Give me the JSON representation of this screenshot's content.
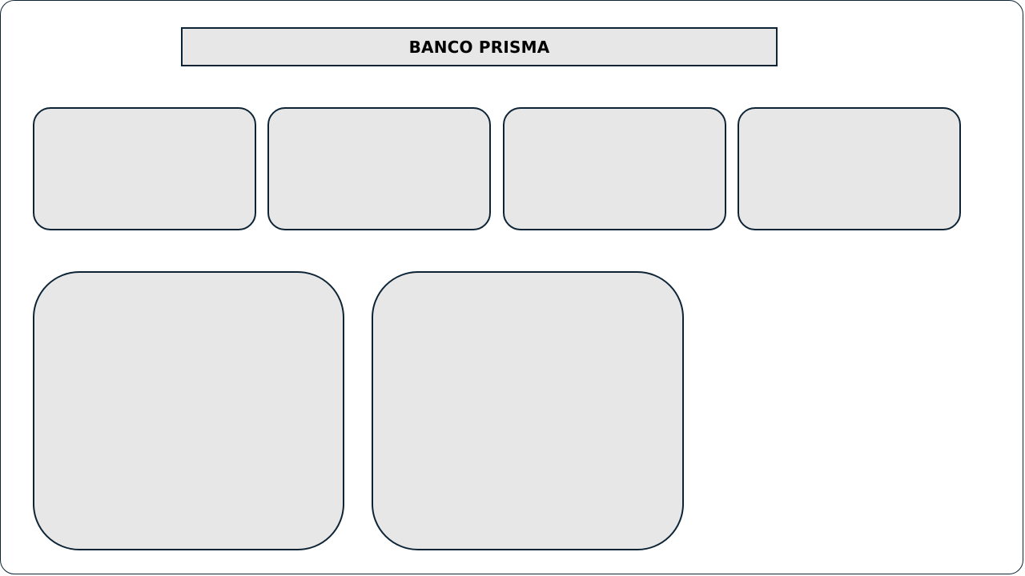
{
  "header": {
    "title": "BANCO PRISMA"
  },
  "colors": {
    "background": "#ffffff",
    "panel_fill": "#e7e7e7",
    "border": "#0d2436",
    "title_text": "#000000"
  },
  "kpi_cards": [
    {
      "id": "kpi-1"
    },
    {
      "id": "kpi-2"
    },
    {
      "id": "kpi-3"
    },
    {
      "id": "kpi-4"
    }
  ],
  "chart_panels": [
    {
      "id": "panel-1"
    },
    {
      "id": "panel-2"
    }
  ]
}
